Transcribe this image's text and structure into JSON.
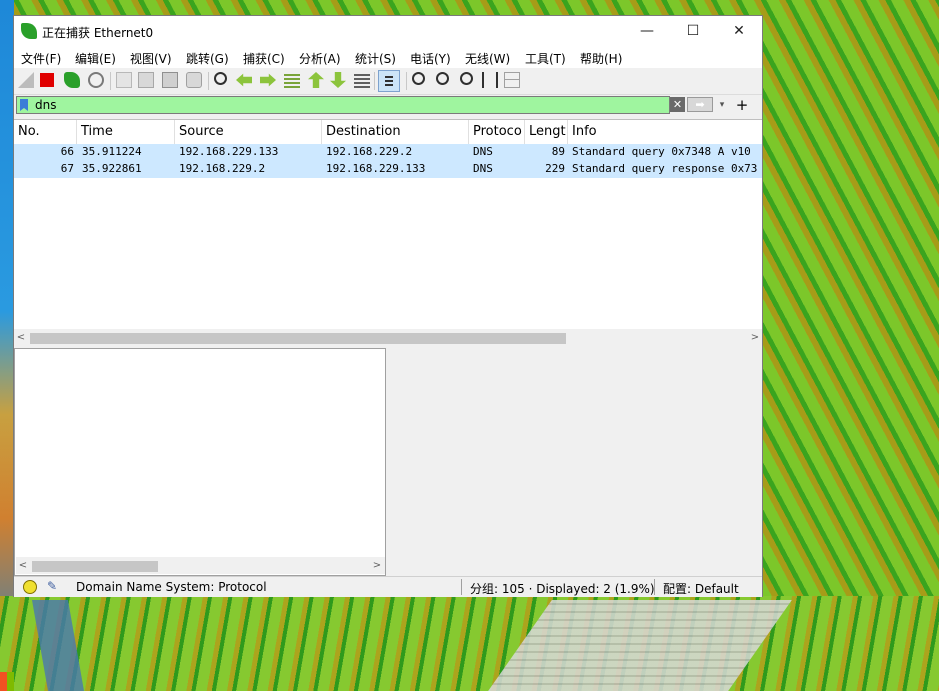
{
  "window": {
    "title": "正在捕获 Ethernet0",
    "minimize": "—",
    "maximize": "☐",
    "close": "✕"
  },
  "menu": [
    "文件(F)",
    "编辑(E)",
    "视图(V)",
    "跳转(G)",
    "捕获(C)",
    "分析(A)",
    "统计(S)",
    "电话(Y)",
    "无线(W)",
    "工具(T)",
    "帮助(H)"
  ],
  "toolbar": {
    "icons": [
      "start-capture-icon",
      "stop-capture-icon",
      "restart-capture-icon",
      "capture-options-icon",
      "open-file-icon",
      "save-file-icon",
      "close-file-icon",
      "reload-file-icon",
      "find-packet-icon",
      "go-back-icon",
      "go-forward-icon",
      "go-to-packet-icon",
      "first-packet-icon",
      "last-packet-icon",
      "autoscroll-icon",
      "colorize-icon",
      "zoom-in-icon",
      "zoom-out-icon",
      "normal-size-icon",
      "resize-columns-icon",
      "layout-icon"
    ]
  },
  "filter": {
    "value": "dns",
    "clear_glyph": "✕",
    "apply_glyph": "➡",
    "dropdown_glyph": "▾",
    "add_glyph": "+"
  },
  "packet_list": {
    "columns": [
      "No.",
      "Time",
      "Source",
      "Destination",
      "Protoco",
      "Lengt",
      "Info"
    ],
    "rows": [
      {
        "no": "66",
        "time": "35.911224",
        "source": "192.168.229.133",
        "destination": "192.168.229.2",
        "protocol": "DNS",
        "length": "89",
        "info": "Standard query 0x7348 A v10"
      },
      {
        "no": "67",
        "time": "35.922861",
        "source": "192.168.229.2",
        "destination": "192.168.229.133",
        "protocol": "DNS",
        "length": "229",
        "info": "Standard query response 0x73"
      }
    ],
    "scroll_left": "<",
    "scroll_right": ">"
  },
  "detail_pane": {
    "scroll_left": "<",
    "scroll_right": ">"
  },
  "status": {
    "field_info": "Domain Name System: Protocol",
    "packets": "分组: 105 · Displayed: 2 (1.9%)",
    "profile": "配置: Default"
  },
  "colors": {
    "filter_valid": "#9ff59f",
    "row_highlight": "#cde8ff"
  }
}
